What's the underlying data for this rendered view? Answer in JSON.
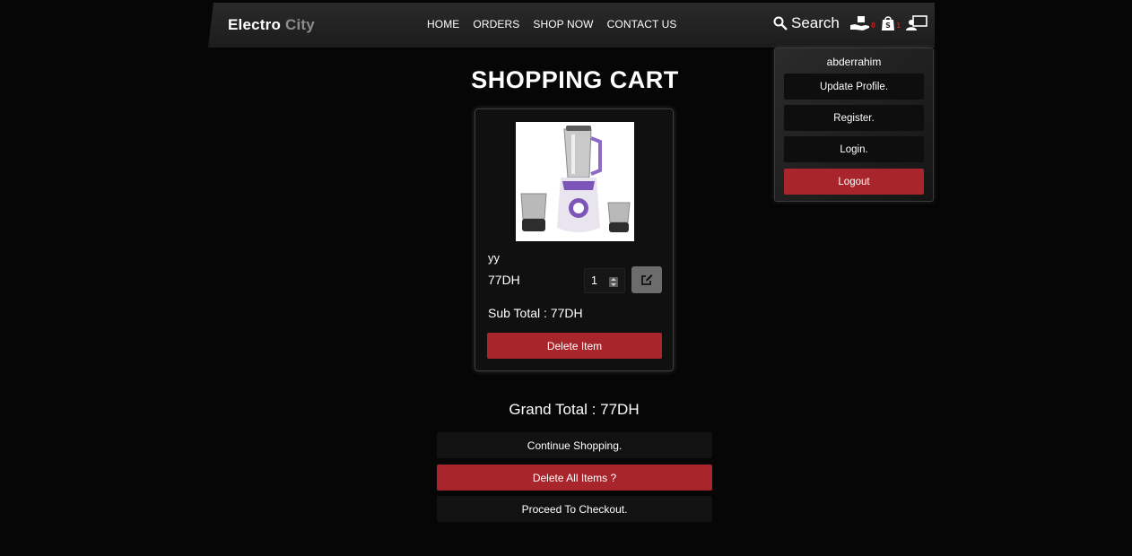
{
  "brand": {
    "part1": "Electro",
    "part2": "City"
  },
  "nav": [
    "HOME",
    "ORDERS",
    "SHOP NOW",
    "CONTACT US"
  ],
  "header_icons": {
    "search_label": "Search",
    "orders_badge": "0",
    "cart_badge": "1"
  },
  "dropdown": {
    "username": "abderrahim",
    "items": [
      "Update Profile.",
      "Register.",
      "Login.",
      "Logout"
    ]
  },
  "page_title": "SHOPPING CART",
  "cart_item": {
    "name": "yy",
    "price": "77DH",
    "quantity": "1",
    "subtotal": "Sub Total : 77DH",
    "delete_label": "Delete Item"
  },
  "grand_total": "Grand Total : 77DH",
  "actions": {
    "continue": "Continue Shopping.",
    "delete_all": "Delete All Items ?",
    "checkout": "Proceed To Checkout."
  },
  "colors": {
    "accent_red": "#a8262b",
    "background": "#060606",
    "header": "#222222"
  }
}
